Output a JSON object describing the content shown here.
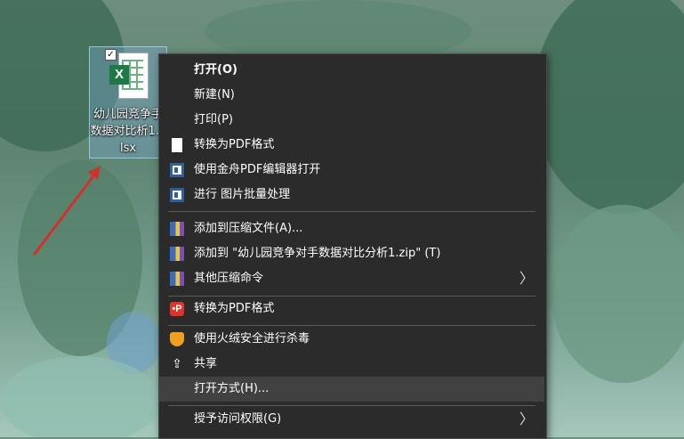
{
  "desktop": {
    "file_name": "幼儿园竞争手数据对比析1.xlsx",
    "file_icon_letter": "X",
    "checkbox_mark": "✓"
  },
  "context_menu": {
    "items": [
      {
        "label": "打开(O)",
        "icon": "none"
      },
      {
        "label": "新建(N)",
        "icon": "none"
      },
      {
        "label": "打印(P)",
        "icon": "none"
      },
      {
        "label": "转换为PDF格式",
        "icon": "document-icon"
      },
      {
        "label": "使用金舟PDF编辑器打开",
        "icon": "pdf-editor-icon"
      },
      {
        "label": "进行 图片批量处理",
        "icon": "image-batch-icon"
      },
      {
        "label": "添加到压缩文件(A)...",
        "icon": "archive-icon"
      },
      {
        "label": "添加到 \"幼儿园竞争对手数据对比分析1.zip\" (T)",
        "icon": "archive-icon"
      },
      {
        "label": "其他压缩命令",
        "icon": "archive-icon",
        "submenu_arrow": "〉"
      },
      {
        "label": "转换为PDF格式",
        "icon": "pdf-convert-icon",
        "icon_text": "•P"
      },
      {
        "label": "使用火绒安全进行杀毒",
        "icon": "shield-icon"
      },
      {
        "label": "共享",
        "icon": "share-icon",
        "icon_text": "⇪"
      },
      {
        "label": "打开方式(H)...",
        "icon": "none",
        "highlighted": true
      },
      {
        "label": "授予访问权限(G)",
        "icon": "none",
        "submenu_arrow": "〉"
      }
    ]
  },
  "colors": {
    "menu_bg": "#2b2b2b",
    "menu_hover": "#414141",
    "annotation_arrow": "#d0322b"
  }
}
